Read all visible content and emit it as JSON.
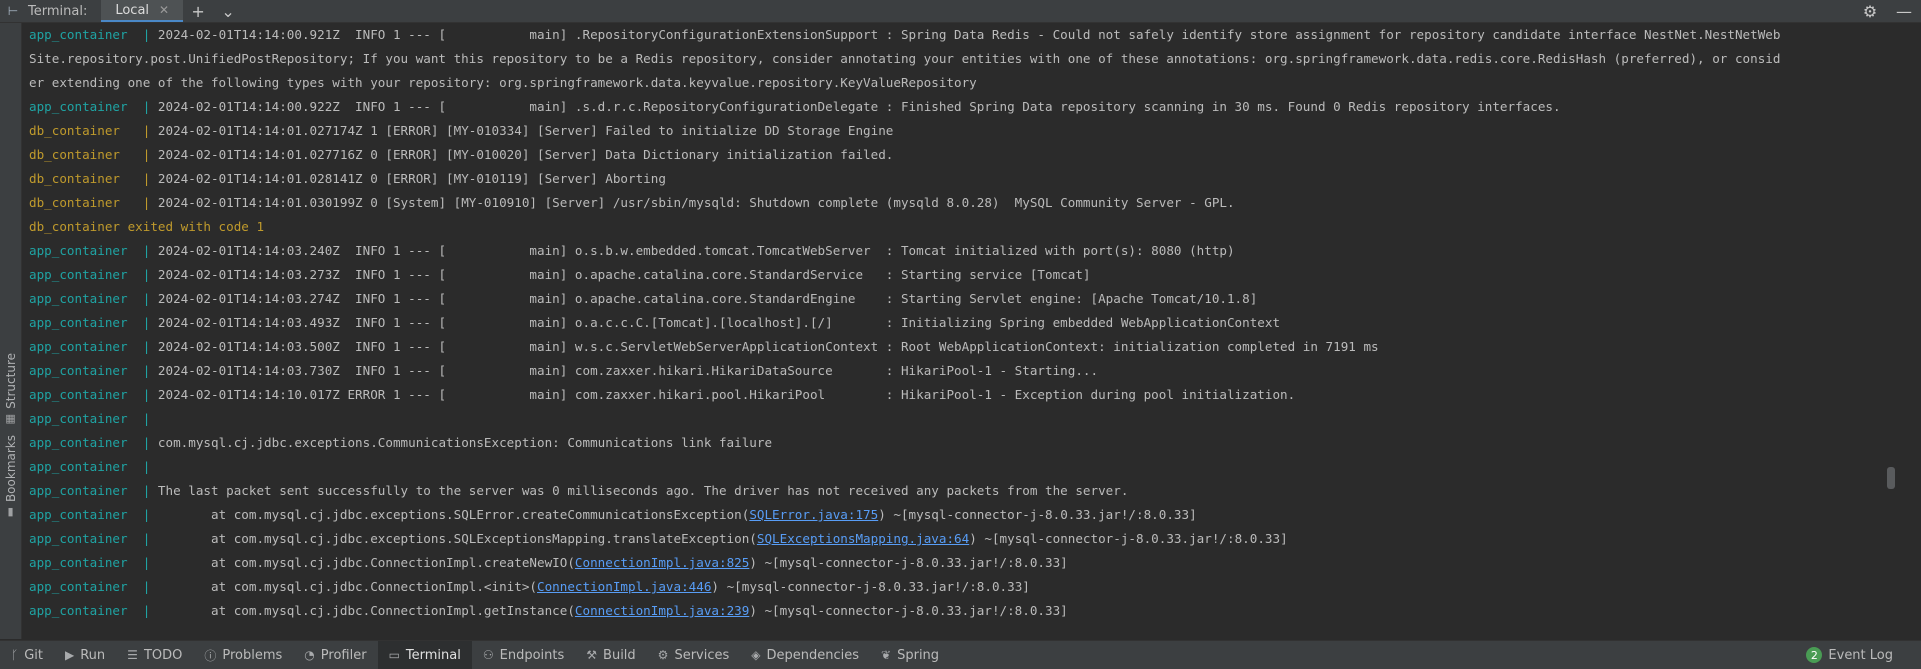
{
  "header": {
    "title": "Terminal:",
    "tab_label": "Local",
    "icons": {
      "panel": "panel-icon",
      "close": "close-icon",
      "add": "plus-icon",
      "more": "chevron-down-icon",
      "settings": "gear-icon",
      "minimize": "minimize-icon"
    }
  },
  "sidebar": {
    "structure_label": "Structure",
    "bookmarks_label": "Bookmarks"
  },
  "terminal": {
    "lines": [
      {
        "type": "app",
        "prefix": "app_container  ",
        "text": "2024-02-01T14:14:00.921Z  INFO 1 --- [           main] .RepositoryConfigurationExtensionSupport : Spring Data Redis - Could not safely identify store assignment for repository candidate interface NestNet.NestNetWeb"
      },
      {
        "type": "plain",
        "text": "Site.repository.post.UnifiedPostRepository; If you want this repository to be a Redis repository, consider annotating your entities with one of these annotations: org.springframework.data.redis.core.RedisHash (preferred), or consid"
      },
      {
        "type": "plain",
        "text": "er extending one of the following types with your repository: org.springframework.data.keyvalue.repository.KeyValueRepository"
      },
      {
        "type": "app",
        "prefix": "app_container  ",
        "text": "2024-02-01T14:14:00.922Z  INFO 1 --- [           main] .s.d.r.c.RepositoryConfigurationDelegate : Finished Spring Data repository scanning in 30 ms. Found 0 Redis repository interfaces."
      },
      {
        "type": "db",
        "prefix": "db_container   ",
        "text": "2024-02-01T14:14:01.027174Z 1 [ERROR] [MY-010334] [Server] Failed to initialize DD Storage Engine"
      },
      {
        "type": "db",
        "prefix": "db_container   ",
        "text": "2024-02-01T14:14:01.027716Z 0 [ERROR] [MY-010020] [Server] Data Dictionary initialization failed."
      },
      {
        "type": "db",
        "prefix": "db_container   ",
        "text": "2024-02-01T14:14:01.028141Z 0 [ERROR] [MY-010119] [Server] Aborting"
      },
      {
        "type": "db",
        "prefix": "db_container   ",
        "text": "2024-02-01T14:14:01.030199Z 0 [System] [MY-010910] [Server] /usr/sbin/mysqld: Shutdown complete (mysqld 8.0.28)  MySQL Community Server - GPL."
      },
      {
        "type": "exit",
        "text": "db_container exited with code 1"
      },
      {
        "type": "app",
        "prefix": "app_container  ",
        "text": "2024-02-01T14:14:03.240Z  INFO 1 --- [           main] o.s.b.w.embedded.tomcat.TomcatWebServer  : Tomcat initialized with port(s): 8080 (http)"
      },
      {
        "type": "app",
        "prefix": "app_container  ",
        "text": "2024-02-01T14:14:03.273Z  INFO 1 --- [           main] o.apache.catalina.core.StandardService   : Starting service [Tomcat]"
      },
      {
        "type": "app",
        "prefix": "app_container  ",
        "text": "2024-02-01T14:14:03.274Z  INFO 1 --- [           main] o.apache.catalina.core.StandardEngine    : Starting Servlet engine: [Apache Tomcat/10.1.8]"
      },
      {
        "type": "app",
        "prefix": "app_container  ",
        "text": "2024-02-01T14:14:03.493Z  INFO 1 --- [           main] o.a.c.c.C.[Tomcat].[localhost].[/]       : Initializing Spring embedded WebApplicationContext"
      },
      {
        "type": "app",
        "prefix": "app_container  ",
        "text": "2024-02-01T14:14:03.500Z  INFO 1 --- [           main] w.s.c.ServletWebServerApplicationContext : Root WebApplicationContext: initialization completed in 7191 ms"
      },
      {
        "type": "app",
        "prefix": "app_container  ",
        "text": "2024-02-01T14:14:03.730Z  INFO 1 --- [           main] com.zaxxer.hikari.HikariDataSource       : HikariPool-1 - Starting..."
      },
      {
        "type": "app",
        "prefix": "app_container  ",
        "text": "2024-02-01T14:14:10.017Z ERROR 1 --- [           main] com.zaxxer.hikari.pool.HikariPool        : HikariPool-1 - Exception during pool initialization."
      },
      {
        "type": "app",
        "prefix": "app_container  ",
        "text": ""
      },
      {
        "type": "app",
        "prefix": "app_container  ",
        "text": "com.mysql.cj.jdbc.exceptions.CommunicationsException: Communications link failure"
      },
      {
        "type": "app",
        "prefix": "app_container  ",
        "text": ""
      },
      {
        "type": "app",
        "prefix": "app_container  ",
        "text": "The last packet sent successfully to the server was 0 milliseconds ago. The driver has not received any packets from the server."
      },
      {
        "type": "app",
        "prefix": "app_container  ",
        "text": "       at com.mysql.cj.jdbc.exceptions.SQLError.createCommunicationsException(",
        "link": "SQLError.java:175",
        "after": ") ~[mysql-connector-j-8.0.33.jar!/:8.0.33]"
      },
      {
        "type": "app",
        "prefix": "app_container  ",
        "text": "       at com.mysql.cj.jdbc.exceptions.SQLExceptionsMapping.translateException(",
        "link": "SQLExceptionsMapping.java:64",
        "after": ") ~[mysql-connector-j-8.0.33.jar!/:8.0.33]"
      },
      {
        "type": "app",
        "prefix": "app_container  ",
        "text": "       at com.mysql.cj.jdbc.ConnectionImpl.createNewIO(",
        "link": "ConnectionImpl.java:825",
        "after": ") ~[mysql-connector-j-8.0.33.jar!/:8.0.33]"
      },
      {
        "type": "app",
        "prefix": "app_container  ",
        "text": "       at com.mysql.cj.jdbc.ConnectionImpl.<init>(",
        "link": "ConnectionImpl.java:446",
        "after": ") ~[mysql-connector-j-8.0.33.jar!/:8.0.33]"
      },
      {
        "type": "app",
        "prefix": "app_container  ",
        "text": "       at com.mysql.cj.jdbc.ConnectionImpl.getInstance(",
        "link": "ConnectionImpl.java:239",
        "after": ") ~[mysql-connector-j-8.0.33.jar!/:8.0.33]"
      }
    ]
  },
  "statusbar": {
    "items": [
      {
        "label": "Git",
        "icon": "git-branch-icon",
        "glyph": "ᚴ"
      },
      {
        "label": "Run",
        "icon": "run-icon",
        "glyph": "▶"
      },
      {
        "label": "TODO",
        "icon": "list-icon",
        "glyph": "☰"
      },
      {
        "label": "Problems",
        "icon": "problems-icon",
        "glyph": "ⓘ"
      },
      {
        "label": "Profiler",
        "icon": "profiler-icon",
        "glyph": "◔"
      },
      {
        "label": "Terminal",
        "icon": "terminal-icon",
        "glyph": "▭",
        "active": true
      },
      {
        "label": "Endpoints",
        "icon": "endpoints-icon",
        "glyph": "⚇"
      },
      {
        "label": "Build",
        "icon": "build-icon",
        "glyph": "⚒"
      },
      {
        "label": "Services",
        "icon": "services-icon",
        "glyph": "⚙"
      },
      {
        "label": "Dependencies",
        "icon": "dependencies-icon",
        "glyph": "◈"
      },
      {
        "label": "Spring",
        "icon": "spring-icon",
        "glyph": "❦"
      }
    ],
    "event_log": {
      "label": "Event Log",
      "count": "2"
    }
  },
  "colors": {
    "app_prefix": "#1fa3a3",
    "db_prefix": "#bf9a2c",
    "link": "#589df6",
    "background": "#2b2b2b"
  }
}
